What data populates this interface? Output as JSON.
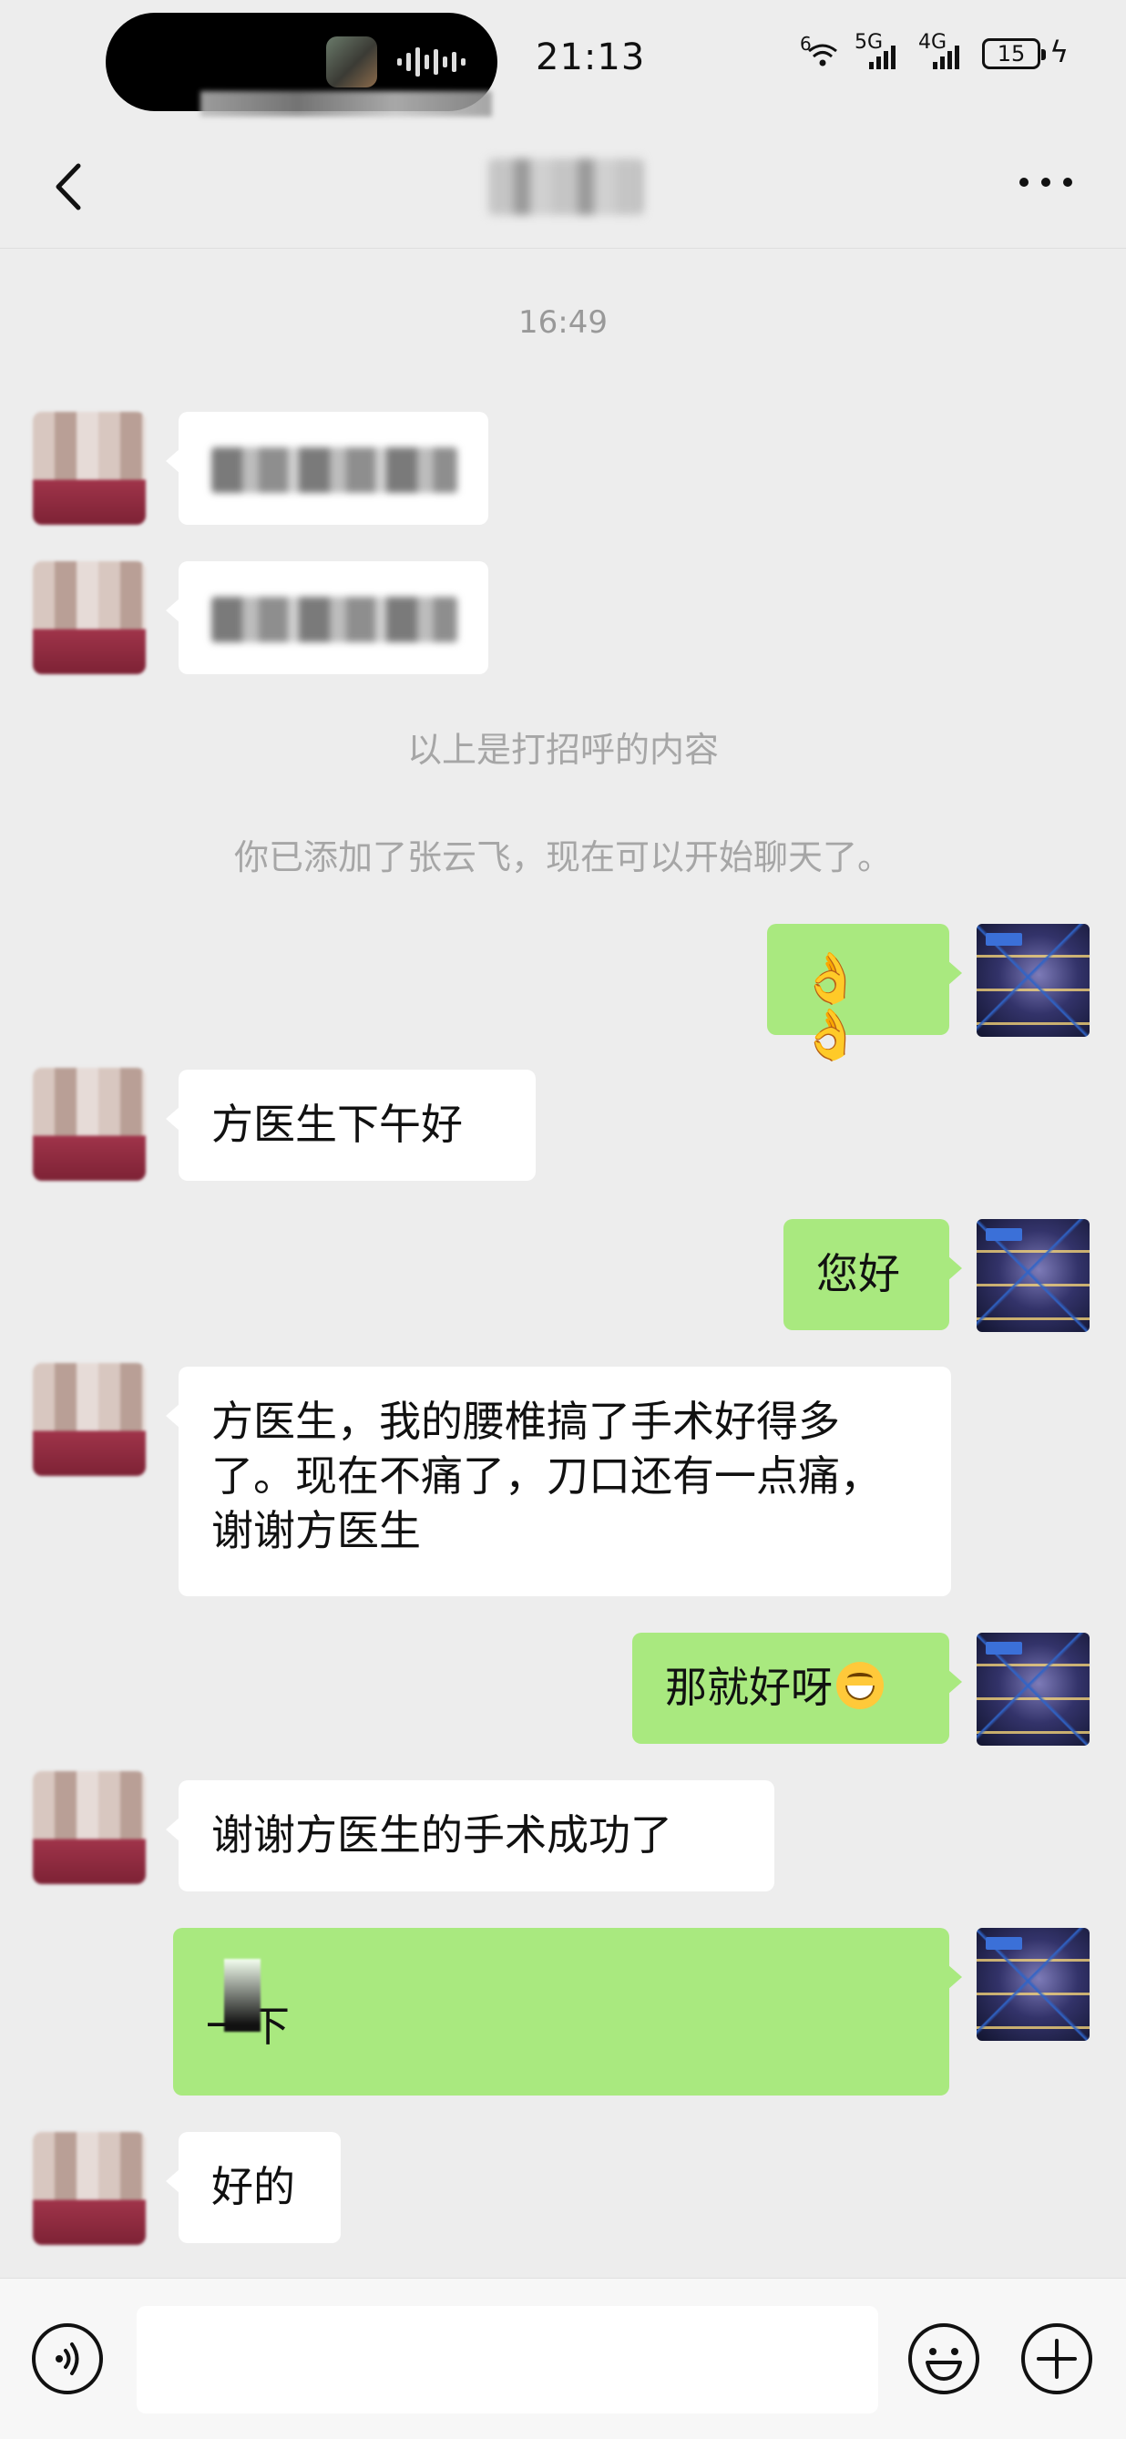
{
  "status_bar": {
    "time": "21:13",
    "signal_1": "5G",
    "signal_2": "4G",
    "battery": "15",
    "sim_index": "6"
  },
  "nav": {
    "back_icon": "chevron-left-icon",
    "more_icon": "more-dots-icon",
    "more_label": "···"
  },
  "chat": {
    "timestamp": "16:49",
    "system_greeting_note": "以上是打招呼的内容",
    "system_added_note": "你已添加了张云飞，现在可以开始聊天了。",
    "messages": [
      {
        "side": "out",
        "text": "👌👌"
      },
      {
        "side": "in",
        "text": "方医生下午好"
      },
      {
        "side": "out",
        "text": "您好"
      },
      {
        "side": "in",
        "text": "方医生，我的腰椎搞了手术好得多了。现在不痛了，刀口还有一点痛，谢谢方医生"
      },
      {
        "side": "out",
        "text": "那就好呀"
      },
      {
        "side": "in",
        "text": "谢谢方医生的手术成功了"
      },
      {
        "side": "out",
        "text": "一下"
      },
      {
        "side": "in",
        "text": "好的"
      }
    ]
  },
  "input_bar": {
    "voice_icon": "voice-icon",
    "emoji_icon": "emoji-icon",
    "plus_icon": "plus-icon"
  }
}
